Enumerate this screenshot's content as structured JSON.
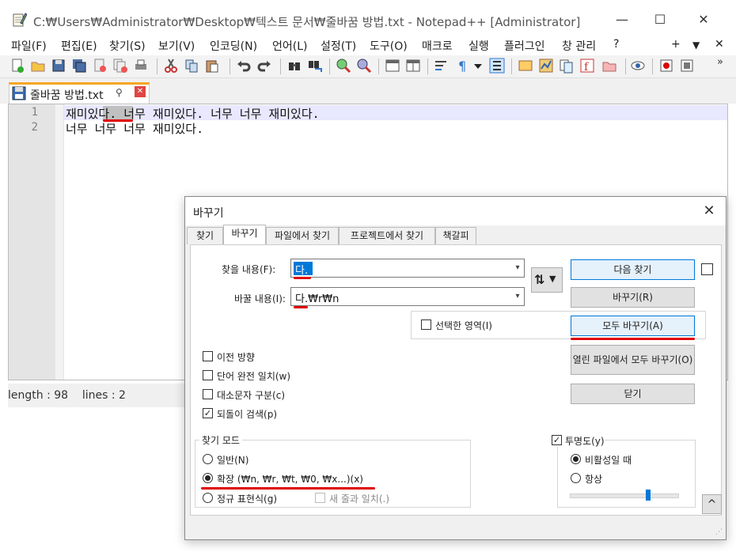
{
  "window": {
    "title": "C:₩Users₩Administrator₩Desktop₩텍스트 문서₩줄바꿈 방법.txt - Notepad++ [Administrator]",
    "minimize": "—",
    "maximize": "☐",
    "close": "✕"
  },
  "menu": {
    "items": [
      "파일(F)",
      "편집(E)",
      "찾기(S)",
      "보기(V)",
      "인코딩(N)",
      "언어(L)",
      "설정(T)",
      "도구(O)",
      "매크로",
      "실행",
      "플러그인",
      "창 관리",
      "?"
    ],
    "right": [
      "+",
      "▼",
      "✕"
    ]
  },
  "tab": {
    "label": "줄바꿈 방법.txt",
    "pin": "📌",
    "close": "✕"
  },
  "editor": {
    "line_numbers": [
      "1",
      "2"
    ],
    "lines": [
      "재미있다. 너무 재미있다. 너무 너무 재미있다.",
      "너무 너무 너무 재미있다."
    ]
  },
  "status": {
    "text": "length : 98    lines : 2"
  },
  "dialog": {
    "title": "바꾸기",
    "close": "✕",
    "tabs": [
      "찾기",
      "바꾸기",
      "파일에서 찾기",
      "프로젝트에서 찾기",
      "책갈피"
    ],
    "find_label": "찾을 내용(F):",
    "find_value": "다.",
    "replace_label": "바꿀 내용(I):",
    "replace_value": "다.₩r₩n",
    "swap_icon": "⇅",
    "in_selection": "선택한 영역(I)",
    "buttons": {
      "find_next": "다음 찾기",
      "replace": "바꾸기(R)",
      "replace_all": "모두 바꾸기(A)",
      "replace_all_open": "열린 파일에서 모두 바꾸기(O)",
      "close": "닫기"
    },
    "options": [
      {
        "label": "이전 방향",
        "checked": false
      },
      {
        "label": "단어 완전 일치(w)",
        "checked": false
      },
      {
        "label": "대소문자 구분(c)",
        "checked": false
      },
      {
        "label": "되돌이 검색(p)",
        "checked": true
      }
    ],
    "search_mode": {
      "title": "찾기 모드",
      "options": [
        "일반(N)",
        "확장 (₩n, ₩r, ₩t, ₩0, ₩x...)(x)",
        "정규 표현식(g)"
      ],
      "selected": 1,
      "dot_newline": "새 줄과 일치(.)"
    },
    "transparency": {
      "title": "투명도(y)",
      "checked": true,
      "options": [
        "비활성일 때",
        "항상"
      ],
      "selected": 0,
      "level": 0.72
    },
    "collapse": "^"
  }
}
